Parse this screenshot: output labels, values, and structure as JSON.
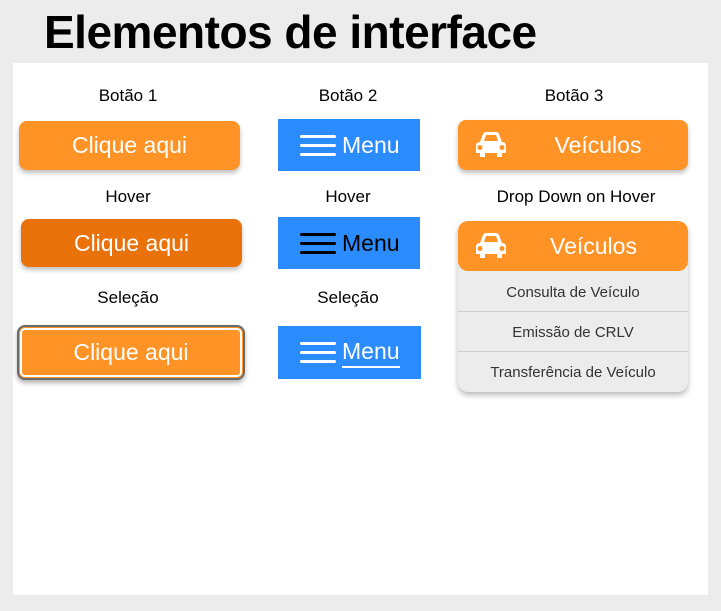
{
  "title": "Elementos de interface",
  "columns": {
    "col1": {
      "header": "Botão 1",
      "hover_label": "Hover",
      "select_label": "Seleção",
      "button_text": "Clique aqui"
    },
    "col2": {
      "header": "Botão 2",
      "hover_label": "Hover",
      "select_label": "Seleção",
      "button_text": "Menu"
    },
    "col3": {
      "header": "Botão 3",
      "dropdown_label": "Drop Down on Hover",
      "button_text": "Veículos",
      "dropdown_items": [
        "Consulta de Veículo",
        "Emissão de CRLV",
        "Transferência de Veículo"
      ]
    }
  },
  "icons": {
    "menu": "hamburger-menu-icon",
    "vehicle": "car-icon"
  },
  "colors": {
    "orange": "#ff9326",
    "orange_hover": "#e9720a",
    "blue": "#2a8cff",
    "canvas": "#ffffff",
    "background": "#ececec"
  }
}
